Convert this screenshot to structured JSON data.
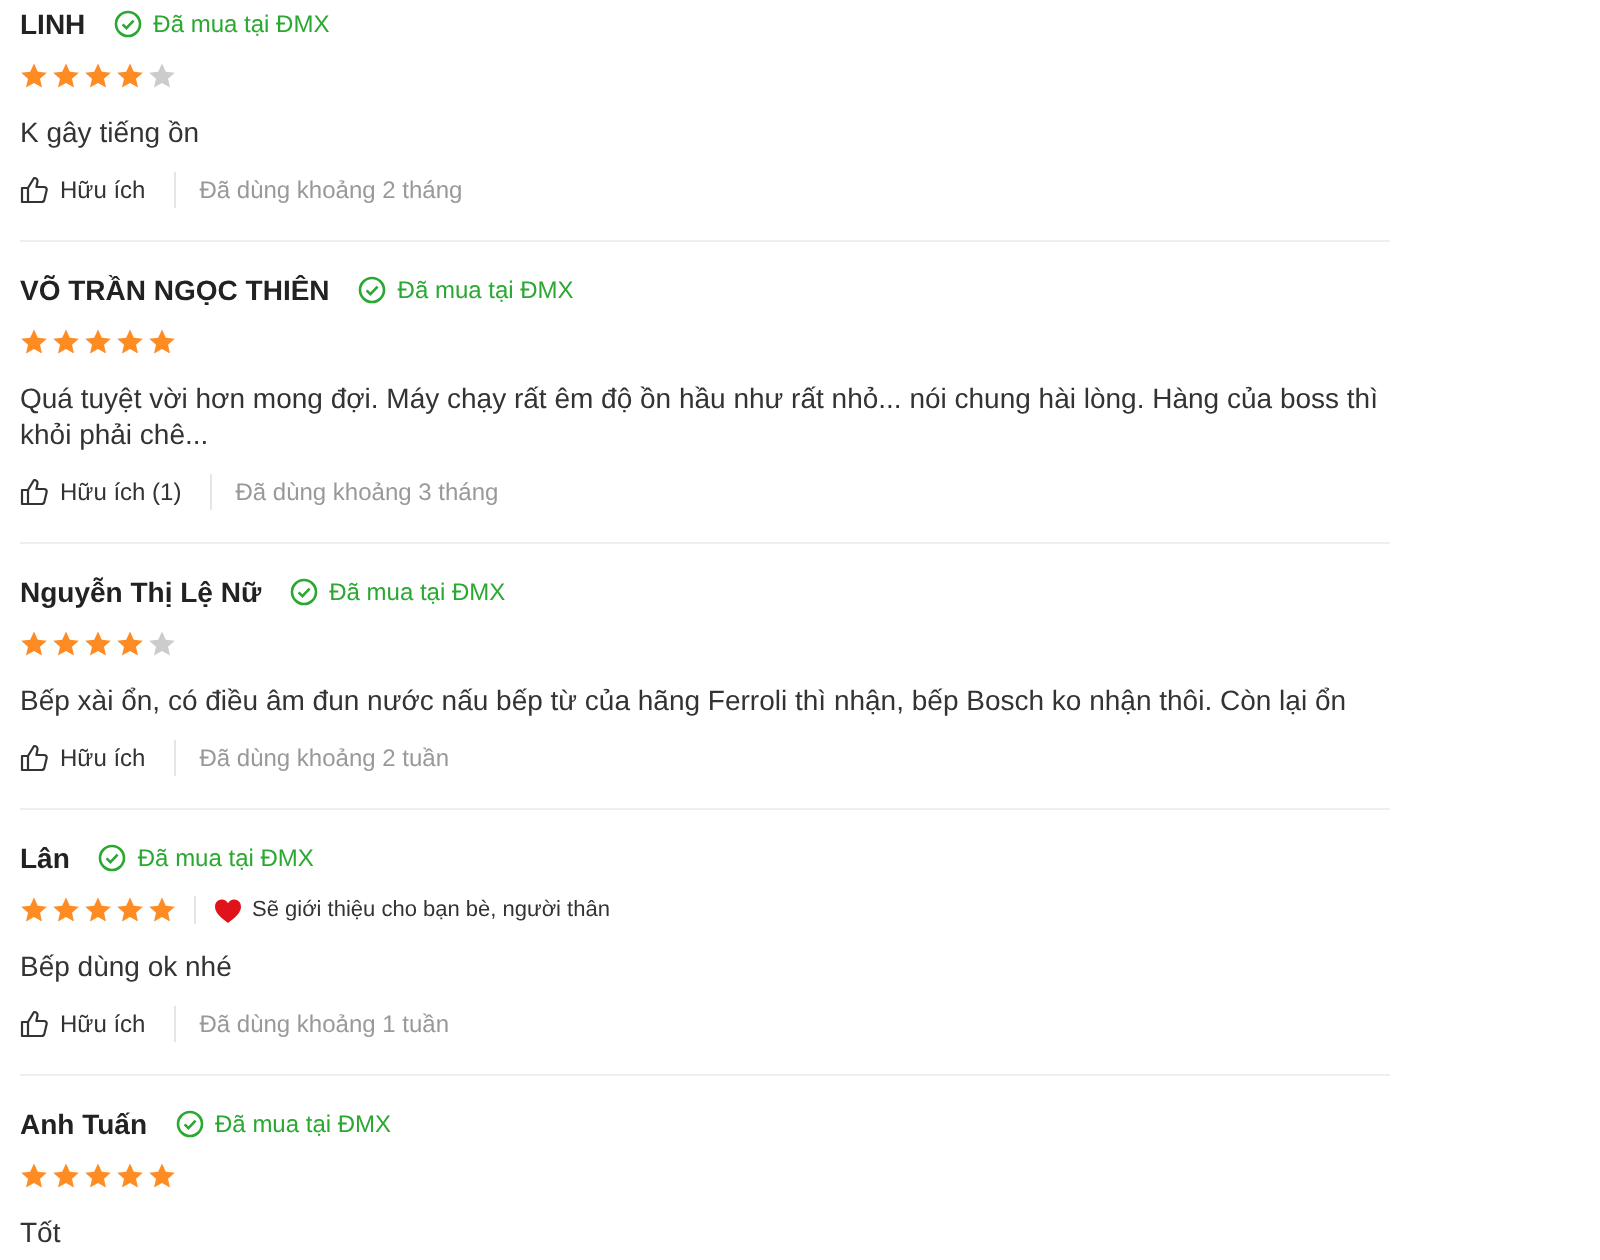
{
  "reviews": [
    {
      "name": "LINH",
      "badge": "Đã mua tại ĐMX",
      "stars": 4,
      "text": "K gây tiếng ồn",
      "helpful": "Hữu ích",
      "usage": "Đã dùng khoảng 2 tháng"
    },
    {
      "name": "VÕ TRẦN NGỌC THIÊN",
      "badge": "Đã mua tại ĐMX",
      "stars": 5,
      "text": "Quá tuyệt vời hơn mong đợi. Máy chạy rất êm độ ồn hầu như rất nhỏ... nói chung hài lòng. Hàng của boss thì khỏi phải chê...",
      "helpful": "Hữu ích (1)",
      "usage": "Đã dùng khoảng 3 tháng"
    },
    {
      "name": "Nguyễn Thị Lệ Nữ",
      "badge": "Đã mua tại ĐMX",
      "stars": 4,
      "text": "Bếp xài ổn, có điều âm đun nước nấu bếp từ của hãng Ferroli thì nhận, bếp Bosch ko nhận thôi. Còn lại ổn",
      "helpful": "Hữu ích",
      "usage": "Đã dùng khoảng 2 tuần"
    },
    {
      "name": "Lân",
      "badge": "Đã mua tại ĐMX",
      "stars": 5,
      "recommend": "Sẽ giới thiệu cho bạn bè, người thân",
      "text": "Bếp dùng ok nhé",
      "helpful": "Hữu ích",
      "usage": "Đã dùng khoảng 1 tuần"
    },
    {
      "name": "Anh Tuấn",
      "badge": "Đã mua tại ĐMX",
      "stars": 5,
      "text": "Tốt"
    }
  ]
}
